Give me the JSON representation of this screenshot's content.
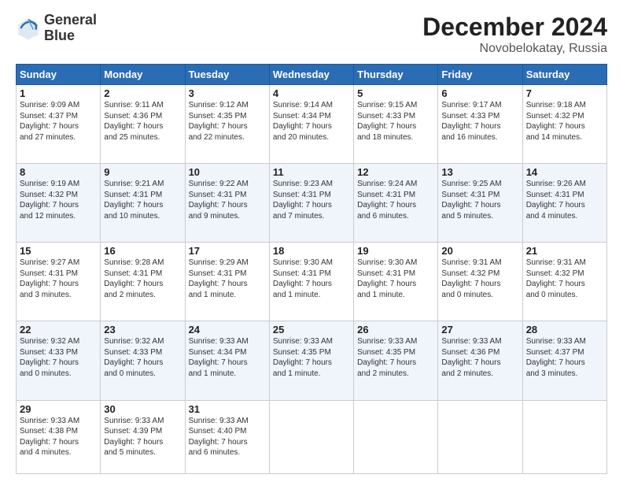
{
  "header": {
    "logo_line1": "General",
    "logo_line2": "Blue",
    "month_title": "December 2024",
    "location": "Novobelokatay, Russia"
  },
  "days_of_week": [
    "Sunday",
    "Monday",
    "Tuesday",
    "Wednesday",
    "Thursday",
    "Friday",
    "Saturday"
  ],
  "weeks": [
    [
      {
        "day": "1",
        "lines": [
          "Sunrise: 9:09 AM",
          "Sunset: 4:37 PM",
          "Daylight: 7 hours",
          "and 27 minutes."
        ]
      },
      {
        "day": "2",
        "lines": [
          "Sunrise: 9:11 AM",
          "Sunset: 4:36 PM",
          "Daylight: 7 hours",
          "and 25 minutes."
        ]
      },
      {
        "day": "3",
        "lines": [
          "Sunrise: 9:12 AM",
          "Sunset: 4:35 PM",
          "Daylight: 7 hours",
          "and 22 minutes."
        ]
      },
      {
        "day": "4",
        "lines": [
          "Sunrise: 9:14 AM",
          "Sunset: 4:34 PM",
          "Daylight: 7 hours",
          "and 20 minutes."
        ]
      },
      {
        "day": "5",
        "lines": [
          "Sunrise: 9:15 AM",
          "Sunset: 4:33 PM",
          "Daylight: 7 hours",
          "and 18 minutes."
        ]
      },
      {
        "day": "6",
        "lines": [
          "Sunrise: 9:17 AM",
          "Sunset: 4:33 PM",
          "Daylight: 7 hours",
          "and 16 minutes."
        ]
      },
      {
        "day": "7",
        "lines": [
          "Sunrise: 9:18 AM",
          "Sunset: 4:32 PM",
          "Daylight: 7 hours",
          "and 14 minutes."
        ]
      }
    ],
    [
      {
        "day": "8",
        "lines": [
          "Sunrise: 9:19 AM",
          "Sunset: 4:32 PM",
          "Daylight: 7 hours",
          "and 12 minutes."
        ]
      },
      {
        "day": "9",
        "lines": [
          "Sunrise: 9:21 AM",
          "Sunset: 4:31 PM",
          "Daylight: 7 hours",
          "and 10 minutes."
        ]
      },
      {
        "day": "10",
        "lines": [
          "Sunrise: 9:22 AM",
          "Sunset: 4:31 PM",
          "Daylight: 7 hours",
          "and 9 minutes."
        ]
      },
      {
        "day": "11",
        "lines": [
          "Sunrise: 9:23 AM",
          "Sunset: 4:31 PM",
          "Daylight: 7 hours",
          "and 7 minutes."
        ]
      },
      {
        "day": "12",
        "lines": [
          "Sunrise: 9:24 AM",
          "Sunset: 4:31 PM",
          "Daylight: 7 hours",
          "and 6 minutes."
        ]
      },
      {
        "day": "13",
        "lines": [
          "Sunrise: 9:25 AM",
          "Sunset: 4:31 PM",
          "Daylight: 7 hours",
          "and 5 minutes."
        ]
      },
      {
        "day": "14",
        "lines": [
          "Sunrise: 9:26 AM",
          "Sunset: 4:31 PM",
          "Daylight: 7 hours",
          "and 4 minutes."
        ]
      }
    ],
    [
      {
        "day": "15",
        "lines": [
          "Sunrise: 9:27 AM",
          "Sunset: 4:31 PM",
          "Daylight: 7 hours",
          "and 3 minutes."
        ]
      },
      {
        "day": "16",
        "lines": [
          "Sunrise: 9:28 AM",
          "Sunset: 4:31 PM",
          "Daylight: 7 hours",
          "and 2 minutes."
        ]
      },
      {
        "day": "17",
        "lines": [
          "Sunrise: 9:29 AM",
          "Sunset: 4:31 PM",
          "Daylight: 7 hours",
          "and 1 minute."
        ]
      },
      {
        "day": "18",
        "lines": [
          "Sunrise: 9:30 AM",
          "Sunset: 4:31 PM",
          "Daylight: 7 hours",
          "and 1 minute."
        ]
      },
      {
        "day": "19",
        "lines": [
          "Sunrise: 9:30 AM",
          "Sunset: 4:31 PM",
          "Daylight: 7 hours",
          "and 1 minute."
        ]
      },
      {
        "day": "20",
        "lines": [
          "Sunrise: 9:31 AM",
          "Sunset: 4:32 PM",
          "Daylight: 7 hours",
          "and 0 minutes."
        ]
      },
      {
        "day": "21",
        "lines": [
          "Sunrise: 9:31 AM",
          "Sunset: 4:32 PM",
          "Daylight: 7 hours",
          "and 0 minutes."
        ]
      }
    ],
    [
      {
        "day": "22",
        "lines": [
          "Sunrise: 9:32 AM",
          "Sunset: 4:33 PM",
          "Daylight: 7 hours",
          "and 0 minutes."
        ]
      },
      {
        "day": "23",
        "lines": [
          "Sunrise: 9:32 AM",
          "Sunset: 4:33 PM",
          "Daylight: 7 hours",
          "and 0 minutes."
        ]
      },
      {
        "day": "24",
        "lines": [
          "Sunrise: 9:33 AM",
          "Sunset: 4:34 PM",
          "Daylight: 7 hours",
          "and 1 minute."
        ]
      },
      {
        "day": "25",
        "lines": [
          "Sunrise: 9:33 AM",
          "Sunset: 4:35 PM",
          "Daylight: 7 hours",
          "and 1 minute."
        ]
      },
      {
        "day": "26",
        "lines": [
          "Sunrise: 9:33 AM",
          "Sunset: 4:35 PM",
          "Daylight: 7 hours",
          "and 2 minutes."
        ]
      },
      {
        "day": "27",
        "lines": [
          "Sunrise: 9:33 AM",
          "Sunset: 4:36 PM",
          "Daylight: 7 hours",
          "and 2 minutes."
        ]
      },
      {
        "day": "28",
        "lines": [
          "Sunrise: 9:33 AM",
          "Sunset: 4:37 PM",
          "Daylight: 7 hours",
          "and 3 minutes."
        ]
      }
    ],
    [
      {
        "day": "29",
        "lines": [
          "Sunrise: 9:33 AM",
          "Sunset: 4:38 PM",
          "Daylight: 7 hours",
          "and 4 minutes."
        ]
      },
      {
        "day": "30",
        "lines": [
          "Sunrise: 9:33 AM",
          "Sunset: 4:39 PM",
          "Daylight: 7 hours",
          "and 5 minutes."
        ]
      },
      {
        "day": "31",
        "lines": [
          "Sunrise: 9:33 AM",
          "Sunset: 4:40 PM",
          "Daylight: 7 hours",
          "and 6 minutes."
        ]
      },
      null,
      null,
      null,
      null
    ]
  ]
}
